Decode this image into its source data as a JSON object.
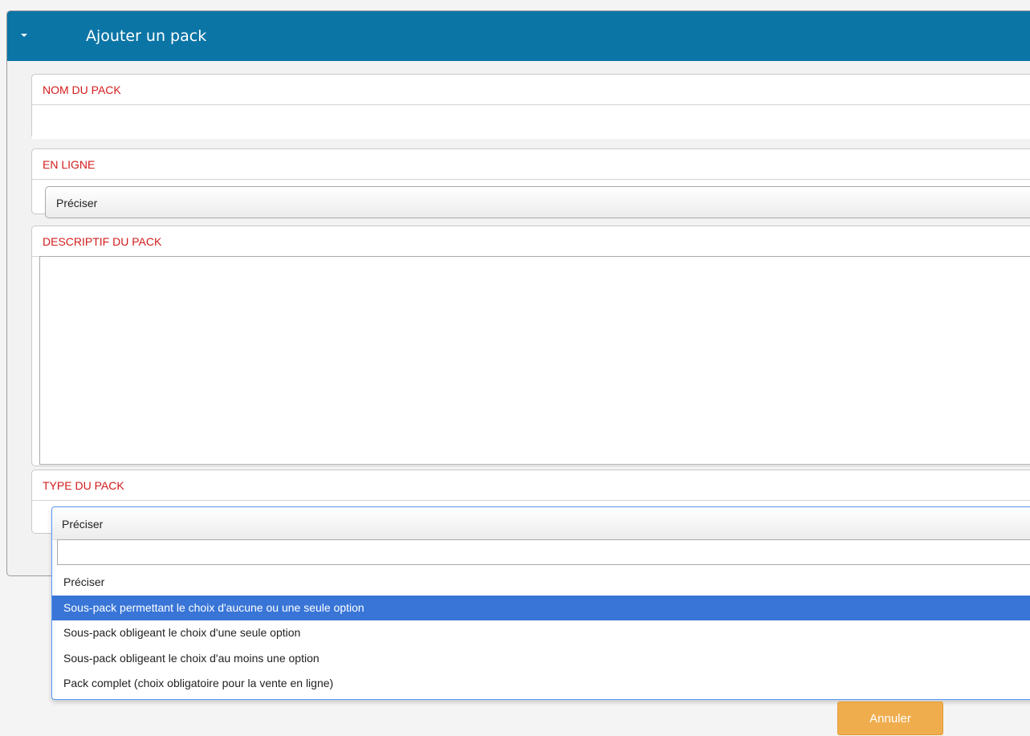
{
  "panel": {
    "title": "Ajouter un pack"
  },
  "fields": {
    "nom": {
      "label": "NOM DU PACK",
      "value": ""
    },
    "en_ligne": {
      "label": "EN LIGNE",
      "selected": "Préciser"
    },
    "descriptif": {
      "label": "DESCRIPTIF DU PACK",
      "value": ""
    },
    "type": {
      "label": "TYPE DU PACK",
      "selected": "Préciser",
      "search_value": "",
      "options": [
        "Préciser",
        "Sous-pack permettant le choix d'aucune ou une seule option",
        "Sous-pack obligeant le choix d'une seule option",
        "Sous-pack obligeant le choix d'au moins une option",
        "Pack complet (choix obligatoire pour la vente en ligne)"
      ],
      "highlighted_index": 1
    }
  },
  "buttons": {
    "cancel": "Annuler"
  },
  "colors": {
    "header": "#0b75a6",
    "label": "#d21c1c",
    "highlight": "#3875d7",
    "cancel": "#f0ad4e"
  }
}
